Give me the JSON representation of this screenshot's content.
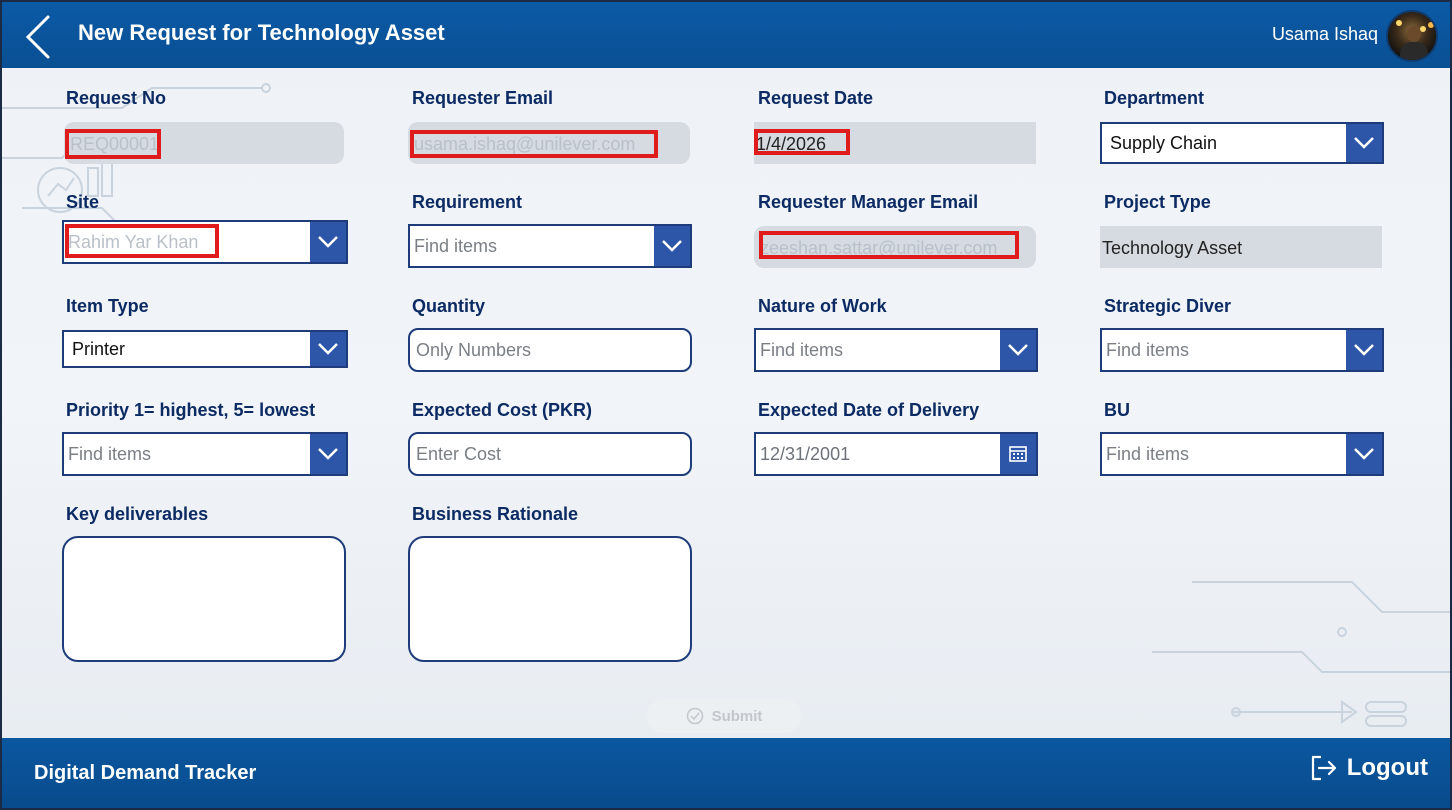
{
  "header": {
    "title": "New Request for Technology Asset",
    "user_name": "Usama Ishaq"
  },
  "form": {
    "request_no": {
      "label": "Request No",
      "value": "REQ00001"
    },
    "requester_email": {
      "label": "Requester Email",
      "value": "usama.ishaq@unilever.com"
    },
    "request_date": {
      "label": "Request Date",
      "value": "1/4/2026"
    },
    "department": {
      "label": "Department",
      "value": "Supply Chain"
    },
    "site": {
      "label": "Site",
      "value": "Rahim Yar Khan"
    },
    "requirement": {
      "label": "Requirement",
      "placeholder": "Find items"
    },
    "requester_manager_email": {
      "label": "Requester Manager Email",
      "value": "zeeshan.sattar@unilever.com"
    },
    "project_type": {
      "label": "Project Type",
      "value": "Technology Asset"
    },
    "item_type": {
      "label": "Item Type",
      "value": "Printer"
    },
    "quantity": {
      "label": "Quantity",
      "placeholder": "Only Numbers"
    },
    "nature_of_work": {
      "label": "Nature of Work",
      "placeholder": "Find items"
    },
    "strategic_diver": {
      "label": "Strategic Diver",
      "placeholder": "Find items"
    },
    "priority": {
      "label": "Priority 1= highest, 5= lowest",
      "placeholder": "Find items"
    },
    "expected_cost": {
      "label": "Expected Cost (PKR)",
      "placeholder": "Enter Cost"
    },
    "expected_delivery": {
      "label": "Expected Date of Delivery",
      "value": "12/31/2001"
    },
    "bu": {
      "label": "BU",
      "placeholder": "Find items"
    },
    "key_deliverables": {
      "label": "Key deliverables"
    },
    "business_rationale": {
      "label": "Business Rationale"
    },
    "submit_label": "Submit"
  },
  "footer": {
    "title": "Digital Demand Tracker",
    "logout_label": "Logout"
  },
  "colors": {
    "header_blue": "#0b5aa6",
    "label_navy": "#0c2a63",
    "chevron_blue": "#2d56a8",
    "redaction_red": "#e01b1b"
  }
}
